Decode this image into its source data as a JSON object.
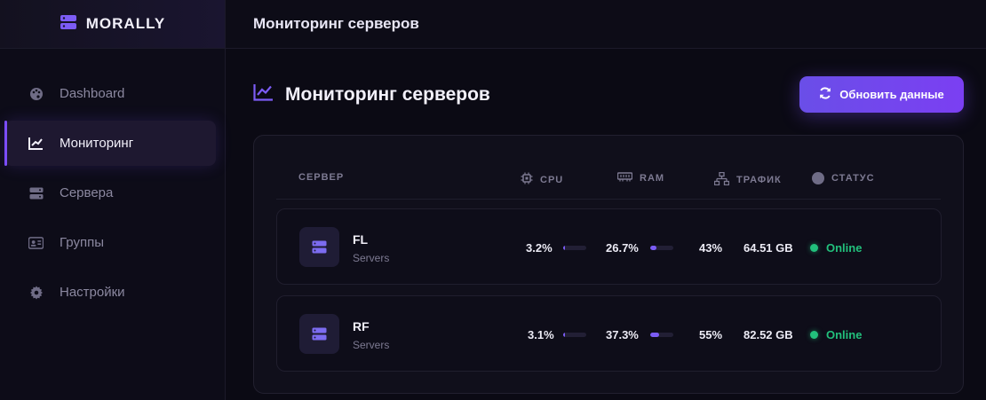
{
  "brand": {
    "name": "MORALLY",
    "icon": "server-stack-icon",
    "accent": "#7c4dff"
  },
  "topbar": {
    "title": "Мониторинг серверов"
  },
  "sidebar": {
    "items": [
      {
        "label": "Dashboard",
        "icon": "palette-icon",
        "active": false
      },
      {
        "label": "Мониторинг",
        "icon": "chart-line-icon",
        "active": true
      },
      {
        "label": "Сервера",
        "icon": "server-icon",
        "active": false
      },
      {
        "label": "Группы",
        "icon": "id-card-icon",
        "active": false
      },
      {
        "label": "Настройки",
        "icon": "gear-icon",
        "active": false
      }
    ]
  },
  "page": {
    "title": "Мониторинг серверов",
    "refresh_label": "Обновить данные"
  },
  "table": {
    "headers": {
      "server": "СЕРВЕР",
      "cpu": "CPU",
      "ram": "RAM",
      "traffic": "ТРАФИК",
      "status": "СТАТУС"
    },
    "rows": [
      {
        "name": "FL",
        "group": "Servers",
        "cpu": "3.2%",
        "cpu_fill": 0.032,
        "ram": "26.7%",
        "ram_fill": 0.267,
        "traffic_pct": "43%",
        "traffic": "64.51 GB",
        "status": "Online"
      },
      {
        "name": "RF",
        "group": "Servers",
        "cpu": "3.1%",
        "cpu_fill": 0.031,
        "ram": "37.3%",
        "ram_fill": 0.373,
        "traffic_pct": "55%",
        "traffic": "82.52 GB",
        "status": "Online"
      }
    ]
  },
  "colors": {
    "online": "#22c07c",
    "accent": "#7c4dff",
    "bar": "#7b5cf5"
  }
}
